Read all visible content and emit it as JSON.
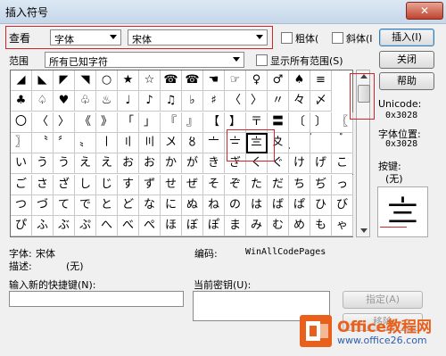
{
  "window": {
    "title": "插入符号",
    "close_glyph": "✕"
  },
  "top": {
    "view_label": "查看",
    "view_value": "字体",
    "font_value": "宋体",
    "bold_label": "粗体(",
    "italic_label": "斜体(I",
    "insert_button": "插入(I)"
  },
  "range": {
    "label": "范围",
    "value": "所有已知字符",
    "show_all_label": "显示所有范围(S)",
    "close_button": "关闭",
    "help_button": "帮助"
  },
  "grid": {
    "rows": [
      [
        "◢",
        "◣",
        "◤",
        "◥",
        "○",
        "★",
        "☆",
        "☎",
        "☎",
        "☚",
        "☞",
        "♀",
        "♂",
        "♠",
        "≡"
      ],
      [
        "♣",
        "♤",
        "♥",
        "♧",
        "♨",
        "♩",
        "♪",
        "♫",
        "♭",
        "♯",
        "〈",
        "〉",
        "〃",
        "々",
        "〆"
      ],
      [
        "〇",
        "〈",
        "〉",
        "《",
        "》",
        "「",
        "」",
        "『",
        "』",
        "【",
        "】",
        "〒",
        "〓",
        "〔",
        "〕",
        "〖"
      ],
      [
        "〗",
        "〝",
        "〞",
        "〟",
        "〡",
        "〢",
        "〣",
        "〤",
        "〥",
        "〦",
        "〧",
        "〨",
        "〩",
        "〪",
        "〫",
        "〬"
      ],
      [
        "い",
        "う",
        "う",
        "え",
        "え",
        "お",
        "お",
        "か",
        "が",
        "き",
        "ぎ",
        "く",
        "ぐ",
        "け",
        "げ",
        "こ"
      ],
      [
        "ご",
        "さ",
        "ざ",
        "し",
        "じ",
        "す",
        "ず",
        "せ",
        "ぜ",
        "そ",
        "ぞ",
        "た",
        "だ",
        "ち",
        "ぢ",
        "っ"
      ],
      [
        "つ",
        "づ",
        "て",
        "で",
        "と",
        "ど",
        "な",
        "に",
        "ぬ",
        "ね",
        "の",
        "は",
        "ば",
        "ぱ",
        "ひ",
        "び"
      ],
      [
        "ぴ",
        "ふ",
        "ぶ",
        "ぷ",
        "へ",
        "べ",
        "ぺ",
        "ほ",
        "ぼ",
        "ぽ",
        "ま",
        "み",
        "む",
        "め",
        "も",
        "ゃ"
      ]
    ],
    "selected_char": "〨"
  },
  "info": {
    "unicode_label": "Unicode:",
    "unicode_value": "0x3028",
    "font_pos_label": "字体位置:",
    "font_pos_value": "0x3028",
    "key_label": "按键:",
    "key_value": "(无)"
  },
  "bottom": {
    "font_label": "字体:",
    "font_value": "宋体",
    "encoding_label": "编码:",
    "encoding_value": "WinAllCodePages",
    "desc_label": "描述:",
    "desc_value": "(无)",
    "new_key_label": "输入新的快捷键(N):",
    "current_key_label": "当前密钥(U):",
    "assign_button": "指定(A)",
    "remove_button": "移除"
  },
  "watermark": {
    "brand": "Office教程网",
    "url": "www.office26.com",
    "accent": "#e8601c"
  }
}
